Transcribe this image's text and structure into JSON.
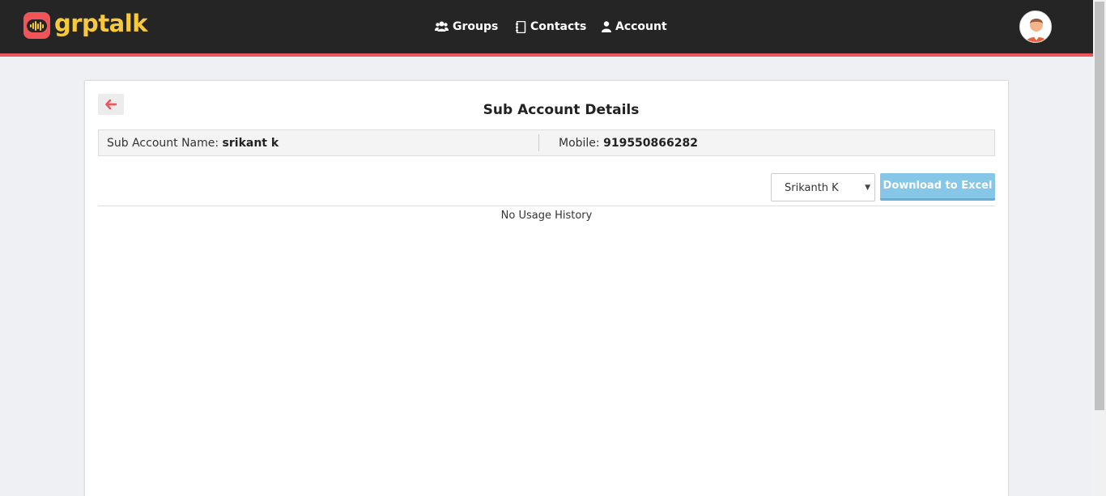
{
  "header": {
    "logo_text": "grptalk",
    "nav": [
      {
        "label": "Groups",
        "icon": "users-icon"
      },
      {
        "label": "Contacts",
        "icon": "address-book-icon"
      },
      {
        "label": "Account",
        "icon": "user-icon"
      }
    ],
    "avatar_icon": "user-avatar-icon",
    "accent_color": "#e8585c",
    "brand_color": "#f8c93a"
  },
  "page": {
    "back_icon": "arrow-left-icon",
    "title": "Sub Account Details",
    "sub_account_label": "Sub Account Name:",
    "sub_account_value": "srikant k",
    "mobile_label": "Mobile:",
    "mobile_value": "919550866282",
    "select_value": "Srikanth K",
    "download_label": "Download to Excel",
    "empty_message": "No Usage History"
  }
}
